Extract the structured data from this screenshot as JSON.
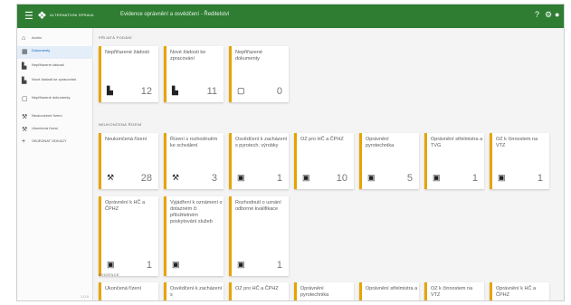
{
  "app": {
    "logo_text": "ALTERNATIVNI SPRAVA",
    "window_title": "Evidence oprávnění a osvědčení - Ředitelství",
    "menu_icon": "menu-icon",
    "top_icons": [
      "help-icon",
      "settings-icon",
      "account-icon"
    ]
  },
  "sidebar": {
    "items": [
      {
        "label": "Archiv",
        "icon": "home-icon"
      },
      {
        "label": "Dokumenty",
        "icon": "list-icon"
      },
      {
        "label": "Nepřiřazené žádosti",
        "icon": "document-icon"
      },
      {
        "label": "Nové žádosti ke zpracování",
        "icon": "document-icon"
      },
      {
        "label": "Nepřiřazené dokumenty",
        "icon": "file-outline-icon"
      },
      {
        "label": "Neukončené řízení",
        "icon": "gavel-icon"
      },
      {
        "label": "Ukončená řízení",
        "icon": "gavel-icon"
      },
      {
        "label": "OBJEDNAT ODKAZY",
        "icon": "plus-icon"
      }
    ],
    "version": "1.0.0"
  },
  "sections": {
    "primary": {
      "title": "PŘIJATÁ PODÁNÍ",
      "cards": [
        {
          "title": "Nepřiřazené žádosti",
          "count": "12",
          "icon": "document-icon"
        },
        {
          "title": "Nové žádosti ke zpracování",
          "count": "11",
          "icon": "document-icon"
        },
        {
          "title": "Nepřiřazené dokumenty",
          "count": "0",
          "icon": "file-outline-icon"
        }
      ]
    },
    "unfinished": {
      "title": "NEUKONČENÁ ŘÍZENÍ",
      "cards": [
        {
          "title": "Neukončená řízení",
          "count": "28",
          "icon": "gavel-icon"
        },
        {
          "title": "Řízení s rozhodnutím ke schválení",
          "count": "3",
          "icon": "gavel-icon"
        },
        {
          "title": "Osvědčení k zacházení s pyrotech. výrobky",
          "count": "1",
          "icon": "image-icon"
        },
        {
          "title": "OZ pro HČ a ČPHZ",
          "count": "10",
          "icon": "image-icon"
        },
        {
          "title": "Oprávnění pyrotechnika",
          "count": "5",
          "icon": "image-icon"
        },
        {
          "title": "Oprávnění střelmistra a TVG",
          "count": "1",
          "icon": "image-icon"
        },
        {
          "title": "OZ k činnostem na VTZ",
          "count": "1",
          "icon": "image-icon"
        },
        {
          "title": "Oprávnění k HČ a ČPHZ",
          "count": "1",
          "icon": "image-icon"
        },
        {
          "title": "Vyjádření k oznámení o dotazném či přiložitelném poskytování služeb",
          "count": "",
          "icon": "image-icon"
        },
        {
          "title": "Rozhodnutí o uznání odborné kvalifikace",
          "count": "1",
          "icon": "image-icon"
        }
      ]
    },
    "evidence": {
      "title": "EVIDENCE",
      "cards": [
        {
          "title": "Ukončená řízení"
        },
        {
          "title": "Osvědčení k zacházení s"
        },
        {
          "title": "OZ pro HČ a ČPHZ"
        },
        {
          "title": "Oprávnění pyrotechnika"
        },
        {
          "title": "Oprávnění střelmistra a"
        },
        {
          "title": "OZ k činnostem na VTZ"
        },
        {
          "title": "Oprávnění k HČ a ČPHZ"
        }
      ]
    }
  },
  "colors": {
    "topbar": "#2e7d32",
    "card_accent": "#e6a400",
    "active_item": "#1565c0"
  }
}
